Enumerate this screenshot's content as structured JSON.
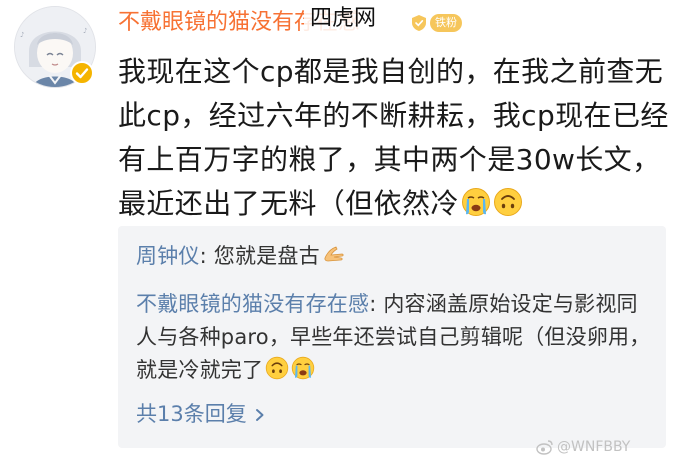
{
  "header": {
    "username": "不戴眼镜的猫没有存在感",
    "site_watermark": "四虎网",
    "level_badge_icon": "shield-badge-icon",
    "level_badge_label": "铁粉"
  },
  "avatar": {
    "icon": "avatar-illustration",
    "verified_icon": "verified-check-icon"
  },
  "post": {
    "text": "我现在这个cp都是我自创的，在我之前查无此cp，经过六年的不断耕耘，我cp现在已经有上百万字的粮了，其中两个是30w长文，最近还出了无料（但依然冷",
    "trailing_emojis": [
      "crying-emoji",
      "upside-down-face-emoji"
    ]
  },
  "replies": [
    {
      "author": "周钟仪",
      "separator": ": ",
      "text": "您就是盘古",
      "emoji": "bowing-hands-emoji"
    },
    {
      "author": "不戴眼镜的猫没有存在感",
      "separator": ": ",
      "text": "内容涵盖原始设定与影视同人与各种paro，早些年还尝试自己剪辑呢（但没卵用，就是冷就完了",
      "emojis": [
        "upside-down-face-emoji",
        "crying-emoji"
      ]
    }
  ],
  "reply_count_label": "共13条回复",
  "reply_count_icon": "chevron-right-icon",
  "footer_watermark": {
    "icon": "weibo-logo-icon",
    "text": "@WNFBBY"
  },
  "colors": {
    "username": "#f77234",
    "reply_author": "#5b7fab",
    "reply_bg": "#f3f4f6",
    "verified_badge": "#f5b400"
  }
}
